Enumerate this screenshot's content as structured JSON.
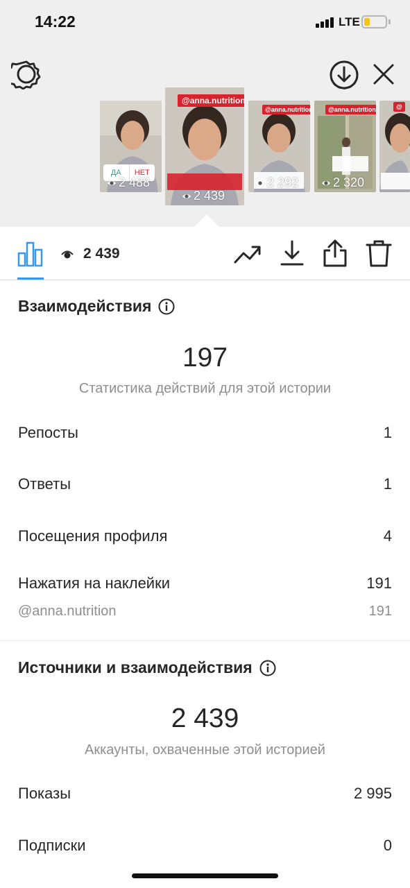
{
  "status_bar": {
    "time": "14:22",
    "network": "LTE"
  },
  "thumbnails": [
    {
      "views": "2 488",
      "poll_yes": "ДА",
      "poll_no": "НЕТ"
    },
    {
      "tag": "@anna.nutrition",
      "views": "2 439"
    },
    {
      "tag": "@anna.nutrition",
      "views": "2 292"
    },
    {
      "tag": "@anna.nutrition",
      "views": "2 320"
    },
    {
      "tag": "@"
    }
  ],
  "toolbar": {
    "views": "2 439"
  },
  "interactions": {
    "title": "Взаимодействия",
    "total": "197",
    "subtitle": "Статистика действий для этой истории",
    "rows": [
      {
        "label": "Репосты",
        "value": "1"
      },
      {
        "label": "Ответы",
        "value": "1"
      },
      {
        "label": "Посещения профиля",
        "value": "4"
      },
      {
        "label": "Нажатия на наклейки",
        "value": "191"
      }
    ],
    "sticker": {
      "label": "@anna.nutrition",
      "value": "191"
    }
  },
  "discovery": {
    "title": "Источники и взаимодействия",
    "total": "2 439",
    "subtitle": "Аккаунты, охваченные этой историей",
    "rows": [
      {
        "label": "Показы",
        "value": "2 995"
      },
      {
        "label": "Подписки",
        "value": "0"
      }
    ]
  },
  "colors": {
    "accent": "#3897f0",
    "tag_red": "#d6232e",
    "poll_green": "#2e9f83",
    "battery": "#f5c518"
  }
}
